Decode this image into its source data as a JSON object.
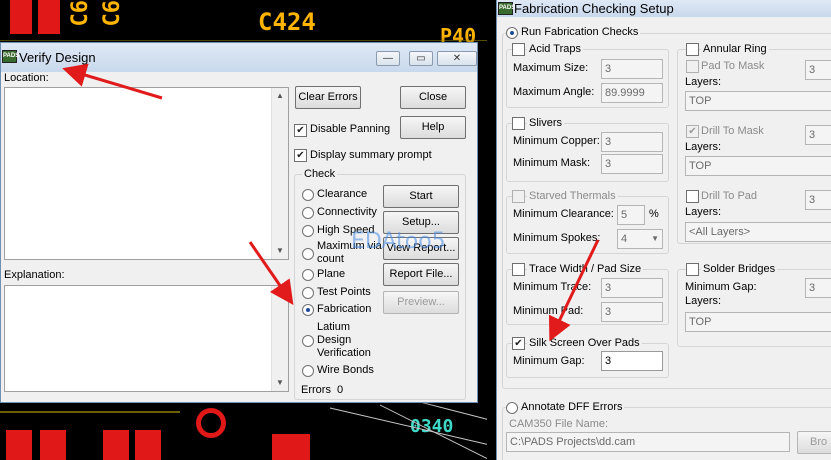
{
  "pcb": {
    "silk_c6": "C6",
    "silk_c424": "C424",
    "silk_p40": "P40",
    "silk_bottom": "0340"
  },
  "verify": {
    "title": "Verify Design",
    "location_label": "Location:",
    "explanation_label": "Explanation:",
    "buttons": {
      "clear_errors": "Clear Errors",
      "close": "Close",
      "help": "Help",
      "start": "Start",
      "setup": "Setup...",
      "view_report": "View Report...",
      "report_file": "Report File...",
      "preview": "Preview..."
    },
    "disable_panning": "Disable Panning",
    "display_summary": "Display summary prompt",
    "check_group": "Check",
    "checks": [
      "Clearance",
      "Connectivity",
      "High Speed",
      "Maximum via count",
      "Plane",
      "Test Points",
      "Fabrication",
      "Latium Design Verification",
      "Wire Bonds"
    ],
    "checks_max_via_1": "Maximum via",
    "checks_max_via_2": "count",
    "checks_latium_1": "Latium",
    "checks_latium_2": "Design",
    "checks_latium_3": "Verification",
    "selected_check": "Fabrication",
    "errors_label": "Errors",
    "errors_value": "0"
  },
  "fab": {
    "title": "Fabrication Checking Setup",
    "run_checks": "Run Fabrication Checks",
    "acid_traps": "Acid Traps",
    "max_size_label": "Maximum Size:",
    "max_size_value": "3",
    "max_angle_label": "Maximum Angle:",
    "max_angle_value": "89.9999",
    "slivers": "Slivers",
    "min_copper_label": "Minimum Copper:",
    "min_copper_value": "3",
    "min_mask_label": "Minimum Mask:",
    "min_mask_value": "3",
    "starved_thermals": "Starved Thermals",
    "min_clearance_label": "Minimum Clearance:",
    "min_clearance_value": "5",
    "min_clearance_unit": "%",
    "min_spokes_label": "Minimum Spokes:",
    "min_spokes_value": "4",
    "trace_width": "Trace Width / Pad Size",
    "min_trace_label": "Minimum Trace:",
    "min_trace_value": "3",
    "min_pad_label": "Minimum Pad:",
    "min_pad_value": "3",
    "silk_screen": "Silk Screen Over Pads",
    "min_gap_label": "Minimum Gap:",
    "min_gap_value": "3",
    "annular_ring": "Annular Ring",
    "pad_to_mask": "Pad To Mask",
    "pad_to_mask_value": "3",
    "layers_label": "Layers:",
    "layer_top": "TOP",
    "drill_to_mask": "Drill To Mask",
    "drill_to_mask_value": "3",
    "drill_to_pad": "Drill To Pad",
    "drill_to_pad_value": "3",
    "all_layers": "<All Layers>",
    "solder_bridges": "Solder Bridges",
    "solder_min_gap_value": "3",
    "annotate_dff": "Annotate DFF Errors",
    "cam350_label": "CAM350 File Name:",
    "cam350_value": "C:\\PADS Projects\\dd.cam",
    "browse": "Bro"
  },
  "watermark": "EDAtoo5",
  "app_icon_label": "PADS",
  "colors": {
    "arrow": "#e11b1b",
    "silkscreen": "#ffb400",
    "pad": "#e01818"
  }
}
